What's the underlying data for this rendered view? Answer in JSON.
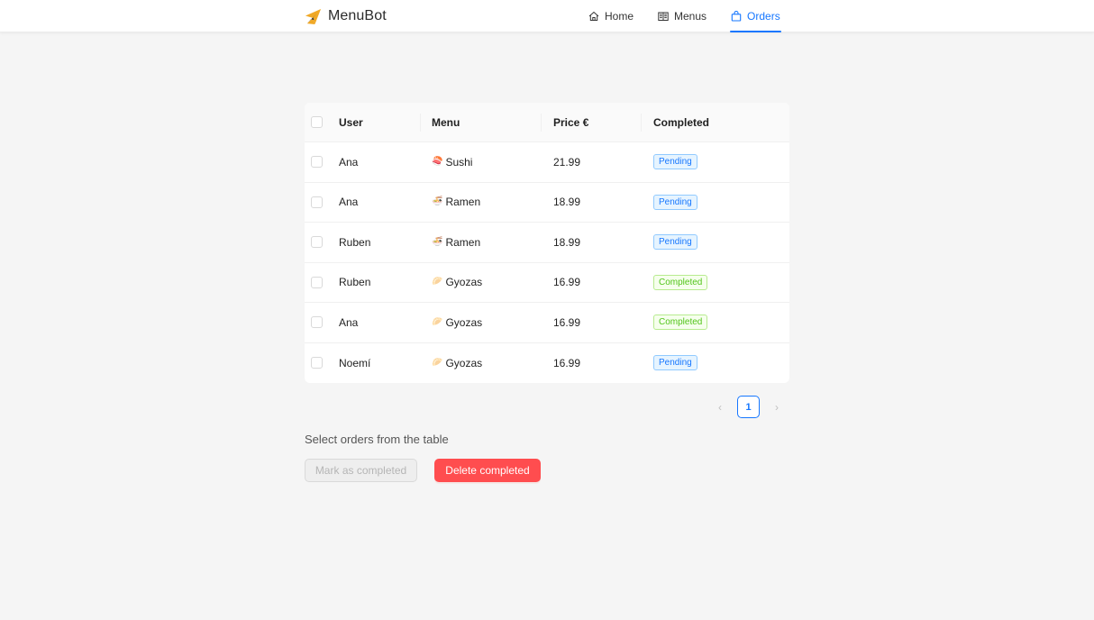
{
  "app": {
    "name": "MenuBot",
    "logo_icon": "paper-plane-icon",
    "brand_color": "#f0a826"
  },
  "nav": {
    "items": [
      {
        "label": "Home",
        "icon": "home-icon",
        "active": false
      },
      {
        "label": "Menus",
        "icon": "book-icon",
        "active": false
      },
      {
        "label": "Orders",
        "icon": "shopping-bag-icon",
        "active": true
      }
    ],
    "active_color": "#1677ff"
  },
  "table": {
    "columns": [
      "User",
      "Menu",
      "Price €",
      "Completed"
    ],
    "rows": [
      {
        "user": "Ana",
        "menu_emoji": "🍣",
        "menu": "Sushi",
        "price": "21.99",
        "status": "Pending"
      },
      {
        "user": "Ana",
        "menu_emoji": "🍜",
        "menu": "Ramen",
        "price": "18.99",
        "status": "Pending"
      },
      {
        "user": "Ruben",
        "menu_emoji": "🍜",
        "menu": "Ramen",
        "price": "18.99",
        "status": "Pending"
      },
      {
        "user": "Ruben",
        "menu_emoji": "🥟",
        "menu": "Gyozas",
        "price": "16.99",
        "status": "Completed"
      },
      {
        "user": "Ana",
        "menu_emoji": "🥟",
        "menu": "Gyozas",
        "price": "16.99",
        "status": "Completed"
      },
      {
        "user": "Noemí",
        "menu_emoji": "🥟",
        "menu": "Gyozas",
        "price": "16.99",
        "status": "Pending"
      }
    ]
  },
  "pagination": {
    "prev": "‹",
    "current_page": "1",
    "next": "›"
  },
  "actions": {
    "hint": "Select orders from the table",
    "mark_completed_label": "Mark as completed",
    "mark_completed_disabled": true,
    "delete_completed_label": "Delete completed"
  },
  "colors": {
    "pending": "#1677ff",
    "completed": "#52c41a",
    "danger": "#ff4d4f"
  }
}
